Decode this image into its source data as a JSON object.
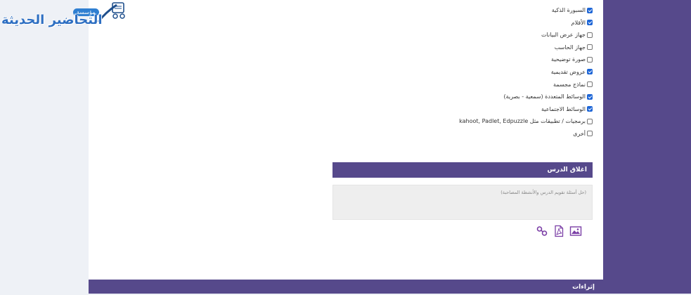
{
  "logo": {
    "brand_text": "التحاضير الحديثة",
    "badge_text": "مؤسسة"
  },
  "tools_list": [
    {
      "label": "السبورة الذكية",
      "checked": true
    },
    {
      "label": "الأقلام",
      "checked": true
    },
    {
      "label": "جهاز عرض البيانات",
      "checked": false
    },
    {
      "label": "جهاز الحاسب",
      "checked": false
    },
    {
      "label": "صورة توضيحية",
      "checked": false
    },
    {
      "label": "عروض تقديمية",
      "checked": true
    },
    {
      "label": "نماذج مجسمة",
      "checked": false
    },
    {
      "label": "الوسائط المتعددة (سمعية - بصرية)",
      "checked": true
    },
    {
      "label": "الوسائط الاجتماعية",
      "checked": true
    },
    {
      "label": "برمجيات / تطبيقات مثل kahoot, Padlet, Edpuzzle",
      "checked": false
    },
    {
      "label": "أخرى",
      "checked": false
    }
  ],
  "lesson_close": {
    "title": "اغلاق الدرس",
    "text": "(حل أسئلة تقويم الدرس والأنشطة المصاحبة)"
  },
  "attachments": {
    "icons": [
      "image-icon",
      "pdf-icon",
      "link-icon"
    ]
  },
  "bottom_section": {
    "title": "إثراءات"
  },
  "colors": {
    "accent": "#56498b",
    "checkbox": "#1e66d6",
    "logo_blue": "#2e6fc2"
  }
}
